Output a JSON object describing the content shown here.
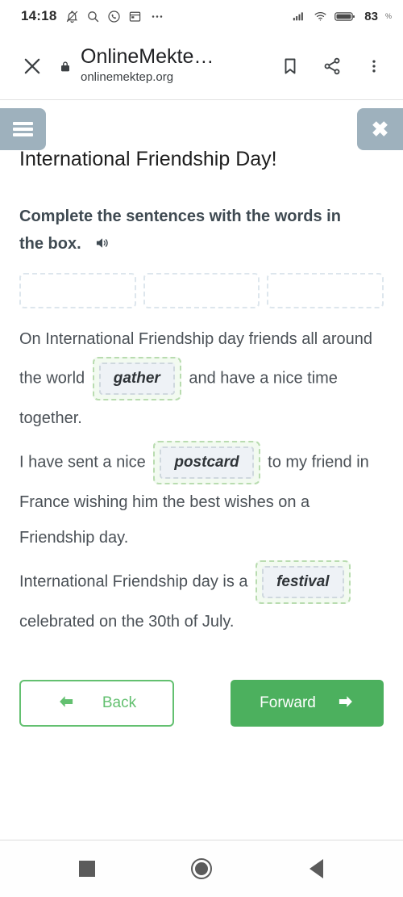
{
  "status_bar": {
    "time": "14:18",
    "left_icons": [
      "bell-muted-icon",
      "search-icon",
      "whatsapp-icon",
      "calendar-icon",
      "more-dots-icon"
    ],
    "right_icons": [
      "signal-icon",
      "wifi-icon",
      "battery-icon"
    ],
    "battery_level": "83",
    "battery_unit": "%"
  },
  "browser": {
    "close_label": "×",
    "lock_icon": "lock-icon",
    "title": "OnlineMekte…",
    "url": "onlinemektep.org",
    "bookmark_icon": "bookmark-icon",
    "share_icon": "share-icon",
    "menu_icon": "overflow-menu-icon"
  },
  "page": {
    "menu_button_label": "menu",
    "close_button_label": "✖",
    "title": "International Friendship Day!",
    "instruction": "Complete the sentences with the words in the box.",
    "audio_icon": "speaker-icon",
    "word_bank": [
      "",
      "",
      ""
    ],
    "sentences": [
      {
        "before": "On International Friendship day friends all around the world",
        "answer": "gather",
        "after": "and have a nice time together."
      },
      {
        "before": "I have sent a nice",
        "answer": "postcard",
        "after": "to my friend in France wishing him the best wishes on a Friendship day."
      },
      {
        "before": "International Friendship day is a",
        "answer": "festival",
        "after": "celebrated on the 30th of July."
      }
    ],
    "back_button": {
      "label": "Back",
      "arrow": "⬅"
    },
    "forward_button": {
      "label": "Forward",
      "arrow": "➡"
    }
  },
  "android_nav": {
    "recents_label": "recents-square",
    "home_label": "home-circle",
    "back_label": "back-triangle"
  },
  "colors": {
    "accent_green": "#4cb05e",
    "accent_green_light": "#63c070",
    "answer_border": "#b9dcb0",
    "answer_fill": "#f2faf0",
    "chip_fill": "#eef2f6",
    "chip_border": "#cfd8de",
    "panel_gray": "#9eb1bd",
    "slot_border": "#dde6ed",
    "text_dark": "#3f4a52",
    "text_body": "#4a5056"
  }
}
